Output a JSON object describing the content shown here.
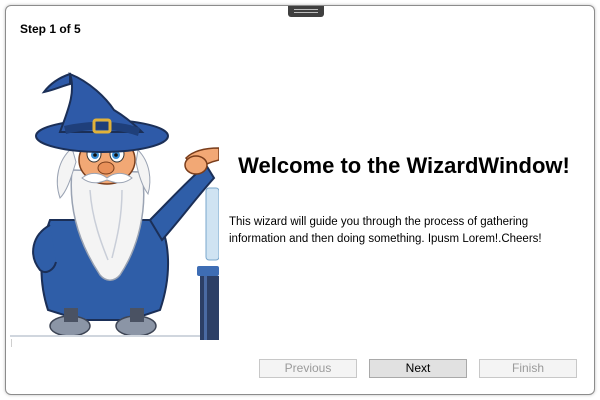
{
  "wizard": {
    "step_label": "Step 1 of 5",
    "title": "Welcome to the WizardWindow!",
    "description": "This wizard will guide you through the process of gathering information and then doing something. Ipusm Lorem!.Cheers!",
    "illustration": "wizard-character-illustration"
  },
  "buttons": {
    "previous": "Previous",
    "next": "Next",
    "finish": "Finish"
  },
  "colors": {
    "wizard_hat": "#2e5aa8",
    "wizard_robe": "#2f5ea8",
    "beard": "#f2f2f2",
    "button_disabled_text": "#9a9a9a"
  }
}
